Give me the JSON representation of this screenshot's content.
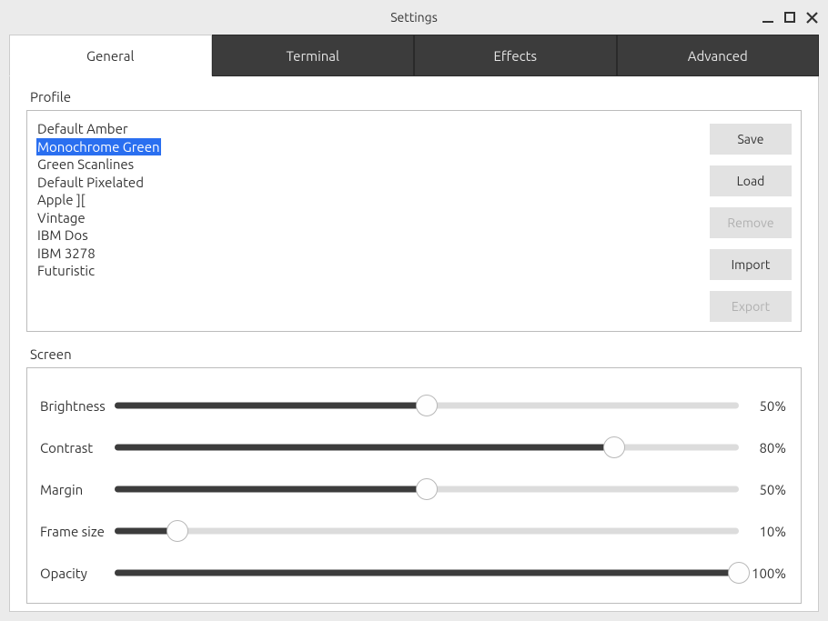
{
  "window": {
    "title": "Settings"
  },
  "tabs": [
    {
      "label": "General",
      "active": true
    },
    {
      "label": "Terminal",
      "active": false
    },
    {
      "label": "Effects",
      "active": false
    },
    {
      "label": "Advanced",
      "active": false
    }
  ],
  "profile": {
    "section_label": "Profile",
    "items": [
      {
        "label": "Default Amber",
        "selected": false
      },
      {
        "label": "Monochrome Green",
        "selected": true
      },
      {
        "label": "Green Scanlines",
        "selected": false
      },
      {
        "label": "Default Pixelated",
        "selected": false
      },
      {
        "label": "Apple ][",
        "selected": false
      },
      {
        "label": "Vintage",
        "selected": false
      },
      {
        "label": "IBM Dos",
        "selected": false
      },
      {
        "label": "IBM 3278",
        "selected": false
      },
      {
        "label": "Futuristic",
        "selected": false
      }
    ],
    "buttons": {
      "save": "Save",
      "load": "Load",
      "remove": "Remove",
      "import": "Import",
      "export": "Export"
    },
    "buttons_disabled": {
      "remove": true,
      "export": true
    }
  },
  "screen": {
    "section_label": "Screen",
    "sliders": [
      {
        "label": "Brightness",
        "value": 50,
        "display": "50%"
      },
      {
        "label": "Contrast",
        "value": 80,
        "display": "80%"
      },
      {
        "label": "Margin",
        "value": 50,
        "display": "50%"
      },
      {
        "label": "Frame size",
        "value": 10,
        "display": "10%"
      },
      {
        "label": "Opacity",
        "value": 100,
        "display": "100%"
      }
    ]
  }
}
